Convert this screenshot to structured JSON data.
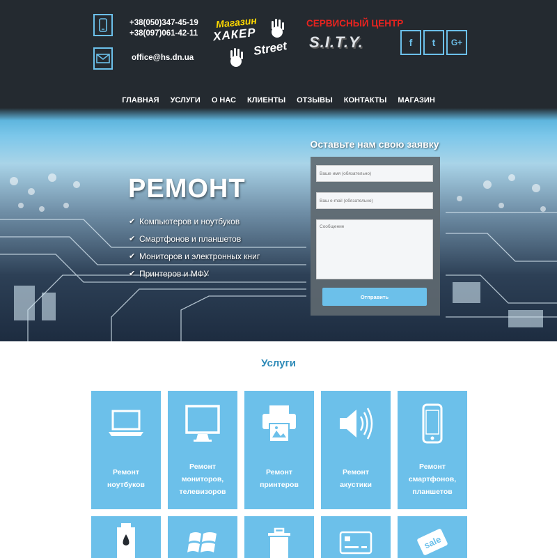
{
  "header": {
    "phone1": "+38(050)347-45-19",
    "phone2": "+38(097)061-42-11",
    "email": "office@hs.dn.ua",
    "logo_shop": {
      "line1": "Магазин",
      "line2": "ХАКЕР",
      "line3": "Street"
    },
    "logo_service": {
      "line1": "СЕРВИСНЫЙ ЦЕНТР",
      "line2": "S.I.T.Y."
    },
    "social": [
      {
        "icon": "facebook-icon",
        "glyph": "f"
      },
      {
        "icon": "twitter-icon",
        "glyph": "t"
      },
      {
        "icon": "google-plus-icon",
        "glyph": "G+"
      }
    ]
  },
  "nav": [
    "ГЛАВНАЯ",
    "УСЛУГИ",
    "О НАС",
    "КЛИЕНТЫ",
    "ОТЗЫВЫ",
    "КОНТАКТЫ",
    "МАГАЗИН"
  ],
  "hero": {
    "title": "РЕМОНТ",
    "items": [
      "Компьютеров и ноутбуков",
      "Смартфонов и планшетов",
      "Мониторов и электронных книг",
      "Принтеров и МФУ"
    ]
  },
  "form": {
    "title": "Оставьте нам свою заявку",
    "name_placeholder": "Ваше имя (обязательно)",
    "email_placeholder": "Ваш e-mail (обязательно)",
    "message_placeholder": "Сообщение",
    "submit_label": "Отправить"
  },
  "services": {
    "title": "Услуги",
    "row1": [
      {
        "icon": "laptop-icon",
        "lines": [
          "Ремонт",
          "ноутбуков"
        ]
      },
      {
        "icon": "monitor-icon",
        "lines": [
          "Ремонт",
          "мониторов,",
          "телевизоров"
        ]
      },
      {
        "icon": "printer-icon",
        "lines": [
          "Ремонт",
          "принтеров"
        ]
      },
      {
        "icon": "speaker-icon",
        "lines": [
          "Ремонт",
          "акустики"
        ]
      },
      {
        "icon": "smartphone-icon",
        "lines": [
          "Ремонт",
          "смартфонов,",
          "планшетов"
        ]
      }
    ],
    "row2": [
      {
        "icon": "ink-cartridge-icon"
      },
      {
        "icon": "windows-icon"
      },
      {
        "icon": "trash-icon"
      },
      {
        "icon": "credit-card-icon"
      },
      {
        "icon": "sale-tag-icon"
      }
    ]
  },
  "colors": {
    "header_bg": "#242a30",
    "accent": "#6cc0ea",
    "title_blue": "#2f8bb8"
  }
}
